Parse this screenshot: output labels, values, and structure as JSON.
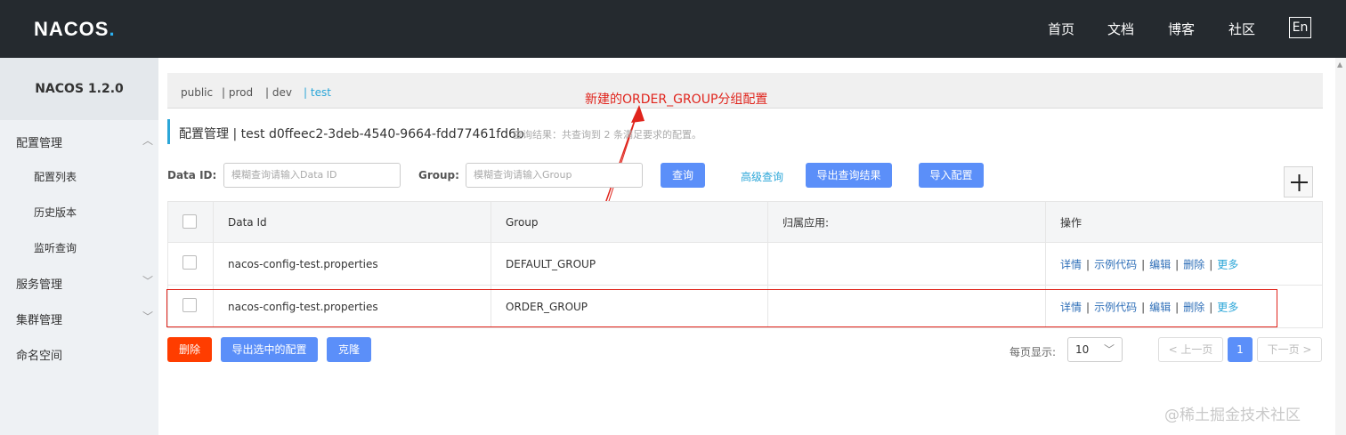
{
  "header": {
    "logo": "NACOS",
    "nav": [
      "首页",
      "文档",
      "博客",
      "社区"
    ],
    "lang": "En"
  },
  "sidebar": {
    "title": "NACOS 1.2.0",
    "groups": [
      {
        "label": "配置管理",
        "items": [
          "配置列表",
          "历史版本",
          "监听查询"
        ]
      },
      {
        "label": "服务管理"
      },
      {
        "label": "集群管理"
      },
      {
        "label": "命名空间"
      }
    ]
  },
  "namespaces": [
    "public",
    "| prod",
    "| dev",
    "| test"
  ],
  "annotation": "新建的ORDER_GROUP分组配置",
  "title": "配置管理 | test d0ffeec2-3deb-4540-9664-fdd77461fd6b",
  "query_result": "查询结果：共查询到 2 条满足要求的配置。",
  "search": {
    "data_id_label": "Data ID:",
    "data_id_placeholder": "模糊查询请输入Data ID",
    "group_label": "Group:",
    "group_placeholder": "模糊查询请输入Group",
    "query": "查询",
    "advanced": "高级查询",
    "export_results": "导出查询结果",
    "import": "导入配置"
  },
  "table": {
    "headers": [
      "Data Id",
      "Group",
      "归属应用:",
      "操作"
    ],
    "rows": [
      {
        "data_id": "nacos-config-test.properties",
        "group": "DEFAULT_GROUP",
        "app": ""
      },
      {
        "data_id": "nacos-config-test.properties",
        "group": "ORDER_GROUP",
        "app": ""
      }
    ],
    "ops": [
      "详情",
      "示例代码",
      "编辑",
      "删除",
      "更多"
    ]
  },
  "footer": {
    "delete": "删除",
    "export_selected": "导出选中的配置",
    "clone": "克隆",
    "page_size_label": "每页显示:",
    "page_size": "10",
    "prev": "< 上一页",
    "current_page": "1",
    "next": "下一页 >"
  },
  "watermark": "@稀土掘金技术社区",
  "colors": {
    "header_bg": "#252a2f",
    "primary": "#5b8ff9",
    "danger": "#ff3d00",
    "annotation": "#e0241c"
  }
}
